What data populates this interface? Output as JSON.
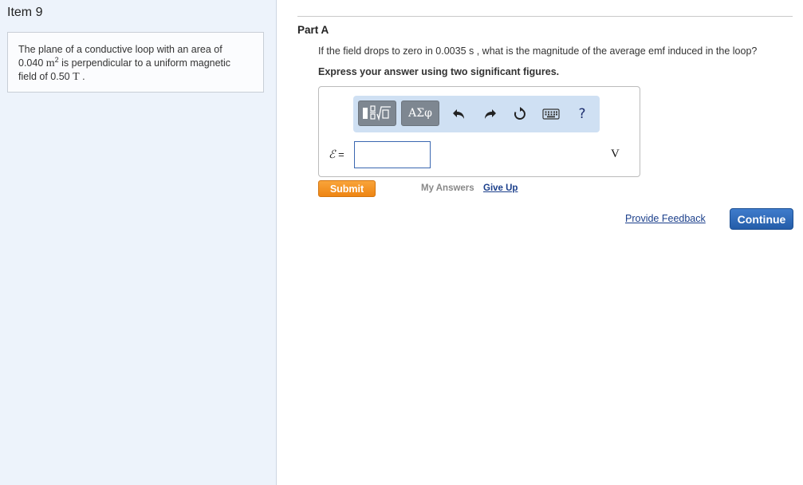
{
  "item": {
    "title": "Item 9"
  },
  "problem": {
    "line1": "The plane of a conductive loop with an area of",
    "area_value": "0.040",
    "area_unit": "m",
    "area_exp": "2",
    "line2_rest": " is perpendicular to a uniform magnetic",
    "line3_prefix": "field of 0.50 ",
    "field_unit": "T",
    "line3_suffix": " ."
  },
  "part": {
    "label": "Part A",
    "question": "If the field drops to zero in 0.0035 s , what is the magnitude of the average emf induced in the loop?",
    "instruction": "Express your answer using two significant figures."
  },
  "toolbar": {
    "greek_label": "ΑΣφ",
    "help_label": "?"
  },
  "answer": {
    "variable": "ℰ",
    "equals": " =",
    "value": "",
    "unit": "V"
  },
  "actions": {
    "submit_label": "Submit",
    "my_answers_label": "My Answers",
    "give_up_label": "Give Up",
    "feedback_label": "Provide Feedback",
    "continue_label": "Continue"
  },
  "colors": {
    "submit": "#f18b1d",
    "continue": "#2e6bbb",
    "link": "#1b3f8b",
    "left_pane": "#edf3fb"
  }
}
